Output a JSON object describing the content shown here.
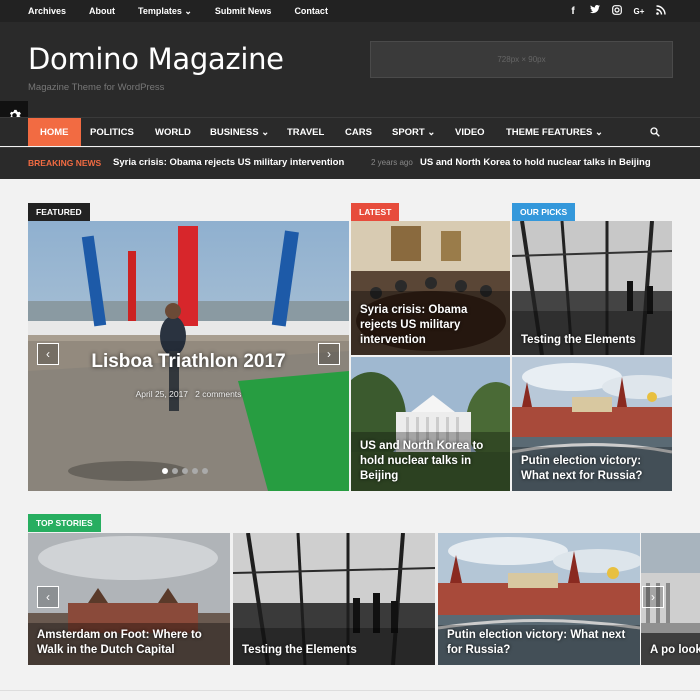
{
  "topbar": {
    "links": [
      "Archives",
      "About",
      "Templates ⌄",
      "Submit News",
      "Contact"
    ],
    "social": [
      "facebook-icon",
      "twitter-icon",
      "instagram-icon",
      "google-plus-icon",
      "rss-icon"
    ],
    "social_glyphs": [
      "f",
      "🐦",
      "◎",
      "G+",
      "◉"
    ]
  },
  "header": {
    "logo": "Domino Magazine",
    "tagline": "Magazine Theme for WordPress",
    "ad": "728px × 90px"
  },
  "nav": {
    "items": [
      "HOME",
      "POLITICS",
      "WORLD",
      "BUSINESS ⌄",
      "TRAVEL",
      "CARS",
      "SPORT ⌄",
      "VIDEO",
      "THEME FEATURES ⌄"
    ],
    "active": "HOME"
  },
  "breaking": {
    "label": "BREAKING NEWS",
    "headline1": "Syria crisis: Obama rejects US military intervention",
    "ago": "2 years ago",
    "headline2": "US and North Korea to hold nuclear talks in Beijing"
  },
  "featured": {
    "tag": "FEATURED",
    "title": "Lisboa Triathlon 2017",
    "date": "April 25, 2017",
    "comments": "2 comments"
  },
  "latest": {
    "tag": "LATEST",
    "items": [
      "Syria crisis: Obama rejects US military intervention",
      "US and North Korea to hold nuclear talks in Beijing"
    ]
  },
  "picks": {
    "tag": "OUR PICKS",
    "items": [
      "Testing the Elements",
      "Putin election victory: What next for Russia?"
    ]
  },
  "top_stories": {
    "tag": "TOP STORIES",
    "items": [
      "Amsterdam on Foot: Where to Walk in the Dutch Capital",
      "Testing the Elements",
      "Putin election victory: What next for Russia?",
      "A po look"
    ]
  },
  "colors": {
    "accent": "#f26b42",
    "featured_tag": "#222222",
    "latest_tag": "#e74c3c",
    "picks_tag": "#3498db",
    "top_tag": "#27ae60"
  }
}
